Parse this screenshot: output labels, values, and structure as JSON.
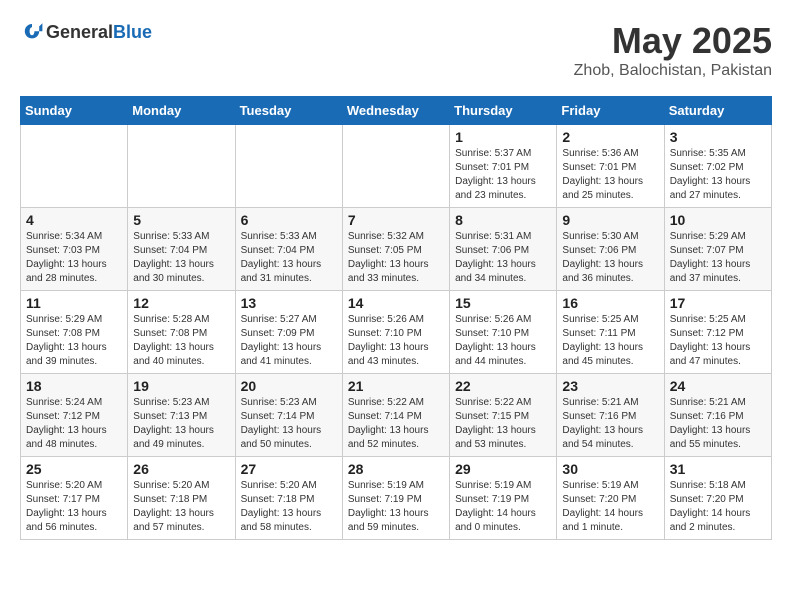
{
  "header": {
    "logo_general": "General",
    "logo_blue": "Blue",
    "month": "May 2025",
    "location": "Zhob, Balochistan, Pakistan"
  },
  "weekdays": [
    "Sunday",
    "Monday",
    "Tuesday",
    "Wednesday",
    "Thursday",
    "Friday",
    "Saturday"
  ],
  "weeks": [
    [
      {
        "day": "",
        "info": ""
      },
      {
        "day": "",
        "info": ""
      },
      {
        "day": "",
        "info": ""
      },
      {
        "day": "",
        "info": ""
      },
      {
        "day": "1",
        "info": "Sunrise: 5:37 AM\nSunset: 7:01 PM\nDaylight: 13 hours\nand 23 minutes."
      },
      {
        "day": "2",
        "info": "Sunrise: 5:36 AM\nSunset: 7:01 PM\nDaylight: 13 hours\nand 25 minutes."
      },
      {
        "day": "3",
        "info": "Sunrise: 5:35 AM\nSunset: 7:02 PM\nDaylight: 13 hours\nand 27 minutes."
      }
    ],
    [
      {
        "day": "4",
        "info": "Sunrise: 5:34 AM\nSunset: 7:03 PM\nDaylight: 13 hours\nand 28 minutes."
      },
      {
        "day": "5",
        "info": "Sunrise: 5:33 AM\nSunset: 7:04 PM\nDaylight: 13 hours\nand 30 minutes."
      },
      {
        "day": "6",
        "info": "Sunrise: 5:33 AM\nSunset: 7:04 PM\nDaylight: 13 hours\nand 31 minutes."
      },
      {
        "day": "7",
        "info": "Sunrise: 5:32 AM\nSunset: 7:05 PM\nDaylight: 13 hours\nand 33 minutes."
      },
      {
        "day": "8",
        "info": "Sunrise: 5:31 AM\nSunset: 7:06 PM\nDaylight: 13 hours\nand 34 minutes."
      },
      {
        "day": "9",
        "info": "Sunrise: 5:30 AM\nSunset: 7:06 PM\nDaylight: 13 hours\nand 36 minutes."
      },
      {
        "day": "10",
        "info": "Sunrise: 5:29 AM\nSunset: 7:07 PM\nDaylight: 13 hours\nand 37 minutes."
      }
    ],
    [
      {
        "day": "11",
        "info": "Sunrise: 5:29 AM\nSunset: 7:08 PM\nDaylight: 13 hours\nand 39 minutes."
      },
      {
        "day": "12",
        "info": "Sunrise: 5:28 AM\nSunset: 7:08 PM\nDaylight: 13 hours\nand 40 minutes."
      },
      {
        "day": "13",
        "info": "Sunrise: 5:27 AM\nSunset: 7:09 PM\nDaylight: 13 hours\nand 41 minutes."
      },
      {
        "day": "14",
        "info": "Sunrise: 5:26 AM\nSunset: 7:10 PM\nDaylight: 13 hours\nand 43 minutes."
      },
      {
        "day": "15",
        "info": "Sunrise: 5:26 AM\nSunset: 7:10 PM\nDaylight: 13 hours\nand 44 minutes."
      },
      {
        "day": "16",
        "info": "Sunrise: 5:25 AM\nSunset: 7:11 PM\nDaylight: 13 hours\nand 45 minutes."
      },
      {
        "day": "17",
        "info": "Sunrise: 5:25 AM\nSunset: 7:12 PM\nDaylight: 13 hours\nand 47 minutes."
      }
    ],
    [
      {
        "day": "18",
        "info": "Sunrise: 5:24 AM\nSunset: 7:12 PM\nDaylight: 13 hours\nand 48 minutes."
      },
      {
        "day": "19",
        "info": "Sunrise: 5:23 AM\nSunset: 7:13 PM\nDaylight: 13 hours\nand 49 minutes."
      },
      {
        "day": "20",
        "info": "Sunrise: 5:23 AM\nSunset: 7:14 PM\nDaylight: 13 hours\nand 50 minutes."
      },
      {
        "day": "21",
        "info": "Sunrise: 5:22 AM\nSunset: 7:14 PM\nDaylight: 13 hours\nand 52 minutes."
      },
      {
        "day": "22",
        "info": "Sunrise: 5:22 AM\nSunset: 7:15 PM\nDaylight: 13 hours\nand 53 minutes."
      },
      {
        "day": "23",
        "info": "Sunrise: 5:21 AM\nSunset: 7:16 PM\nDaylight: 13 hours\nand 54 minutes."
      },
      {
        "day": "24",
        "info": "Sunrise: 5:21 AM\nSunset: 7:16 PM\nDaylight: 13 hours\nand 55 minutes."
      }
    ],
    [
      {
        "day": "25",
        "info": "Sunrise: 5:20 AM\nSunset: 7:17 PM\nDaylight: 13 hours\nand 56 minutes."
      },
      {
        "day": "26",
        "info": "Sunrise: 5:20 AM\nSunset: 7:18 PM\nDaylight: 13 hours\nand 57 minutes."
      },
      {
        "day": "27",
        "info": "Sunrise: 5:20 AM\nSunset: 7:18 PM\nDaylight: 13 hours\nand 58 minutes."
      },
      {
        "day": "28",
        "info": "Sunrise: 5:19 AM\nSunset: 7:19 PM\nDaylight: 13 hours\nand 59 minutes."
      },
      {
        "day": "29",
        "info": "Sunrise: 5:19 AM\nSunset: 7:19 PM\nDaylight: 14 hours\nand 0 minutes."
      },
      {
        "day": "30",
        "info": "Sunrise: 5:19 AM\nSunset: 7:20 PM\nDaylight: 14 hours\nand 1 minute."
      },
      {
        "day": "31",
        "info": "Sunrise: 5:18 AM\nSunset: 7:20 PM\nDaylight: 14 hours\nand 2 minutes."
      }
    ]
  ]
}
